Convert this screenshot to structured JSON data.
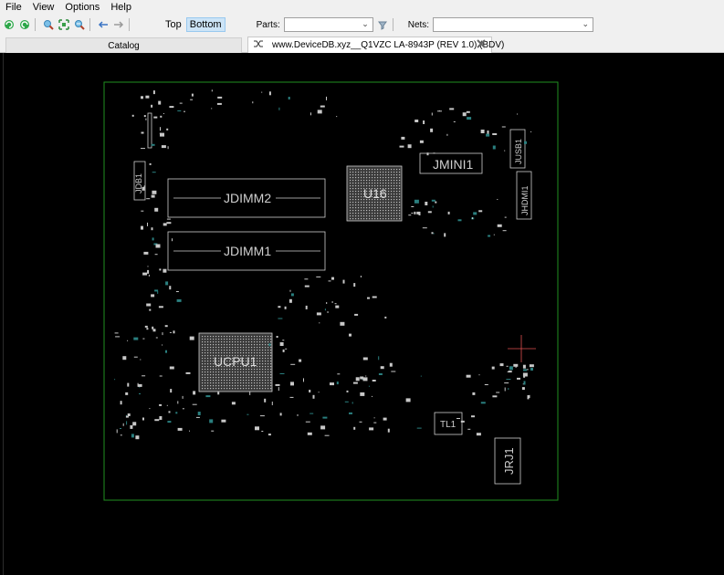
{
  "menu": [
    "File",
    "View",
    "Options",
    "Help"
  ],
  "toolbar": {
    "icons": [
      "rotate-left-icon",
      "rotate-right-icon",
      "zoom-in-icon",
      "fit-icon",
      "zoom-out-icon",
      "back-icon",
      "forward-icon"
    ],
    "view_top": "Top",
    "view_bottom": "Bottom",
    "active_view": "Bottom",
    "parts_label": "Parts:",
    "parts_value": "",
    "nets_label": "Nets:",
    "nets_value": ""
  },
  "tabs": {
    "catalog": "Catalog",
    "document": "www.DeviceDB.xyz__Q1VZC LA-8943P (REV 1.0) (BDV)"
  },
  "board": {
    "outline_color": "#1f8f1f",
    "part_color": "#cfcfcf",
    "labels": {
      "jdb1": "JDB1",
      "jdimm2": "JDIMM2",
      "jdimm1": "JDIMM1",
      "u16": "U16",
      "jmini1": "JMINI1",
      "jusb1": "JUSB1",
      "jhdmi1": "JHDMI1",
      "ucpu1": "UCPU1",
      "tl1": "TL1",
      "jrj1": "JRJ1"
    }
  }
}
